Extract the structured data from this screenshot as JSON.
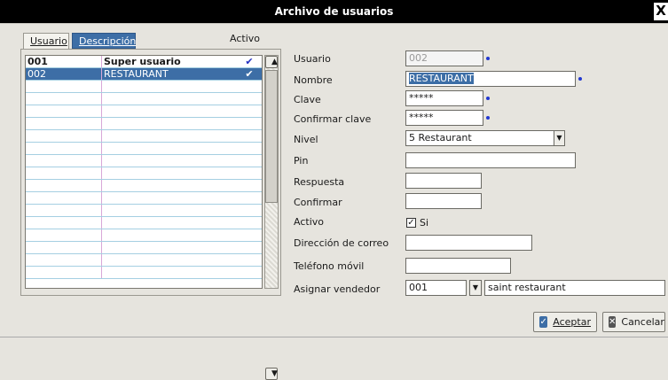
{
  "window": {
    "title": "Archivo de usuarios",
    "close_glyph": "X"
  },
  "tabs": {
    "usuario": "Usuario",
    "descripcion": "Descripción"
  },
  "list": {
    "activo_header": "Activo",
    "rows": [
      {
        "code": "001",
        "desc": "Super usuario",
        "active": "✔"
      },
      {
        "code": "002",
        "desc": "RESTAURANT",
        "active": "✔"
      }
    ]
  },
  "form": {
    "usuario_label": "Usuario",
    "usuario_value": "002",
    "nombre_label": "Nombre",
    "nombre_value": "RESTAURANT",
    "clave_label": "Clave",
    "clave_value": "*****",
    "confirmar_clave_label": "Confirmar clave",
    "confirmar_clave_value": "*****",
    "nivel_label": "Nivel",
    "nivel_value": "5 Restaurant",
    "pin_label": "Pin",
    "pin_value": "",
    "respuesta_label": "Respuesta",
    "respuesta_value": "",
    "confirmar_label": "Confirmar",
    "confirmar_value": "",
    "activo_label": "Activo",
    "activo_check_label": "Si",
    "correo_label": "Dirección de correo",
    "correo_value": "",
    "telefono_label": "Teléfono móvil",
    "telefono_value": "",
    "vendedor_label": "Asignar vendedor",
    "vendedor_code": "001",
    "vendedor_name": "saint restaurant"
  },
  "buttons": {
    "accept": "Aceptar",
    "cancel": "Cancelar"
  },
  "colors": {
    "accent": "#3d6ea6",
    "required_dot": "#2238d0",
    "checkmark": "#2430c0"
  }
}
